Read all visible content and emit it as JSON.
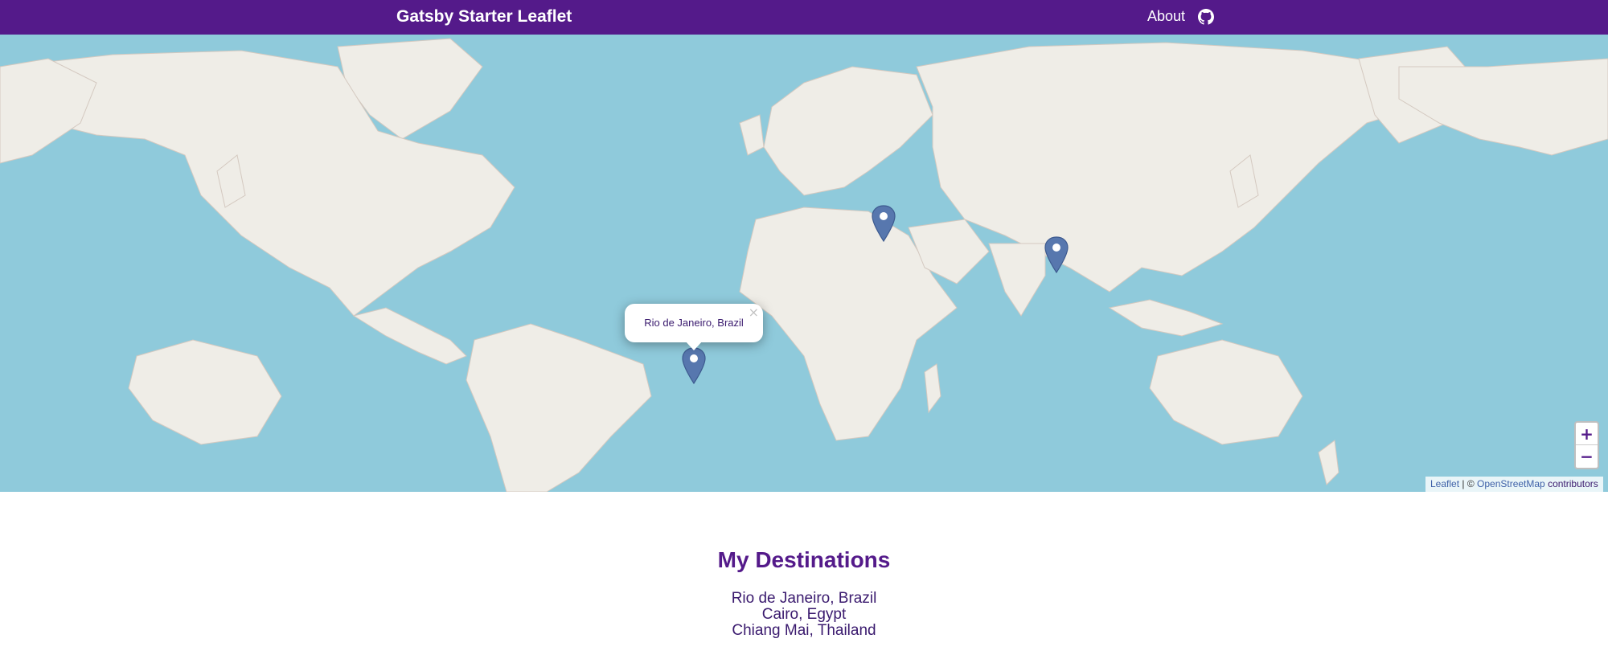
{
  "header": {
    "title": "Gatsby Starter Leaflet",
    "about_label": "About",
    "github_icon": "github-icon"
  },
  "map": {
    "popup": {
      "text": "Rio de Janeiro, Brazil",
      "close_label": "×"
    },
    "markers": [
      {
        "name": "Rio de Janeiro, Brazil",
        "icon": "map-pin-icon"
      },
      {
        "name": "Cairo, Egypt",
        "icon": "map-pin-icon"
      },
      {
        "name": "Chiang Mai, Thailand",
        "icon": "map-pin-icon"
      }
    ],
    "zoom_in_label": "+",
    "zoom_out_label": "−",
    "attribution": {
      "leaflet": "Leaflet",
      "separator": "| ©",
      "osm": "OpenStreetMap",
      "contributors": "contributors"
    }
  },
  "destinations": {
    "title": "My Destinations",
    "items": [
      "Rio de Janeiro, Brazil",
      "Cairo, Egypt",
      "Chiang Mai, Thailand"
    ]
  },
  "colors": {
    "brand": "#541a8a",
    "water": "#8fcadb",
    "land": "#efede7",
    "marker": "#5777ae"
  }
}
